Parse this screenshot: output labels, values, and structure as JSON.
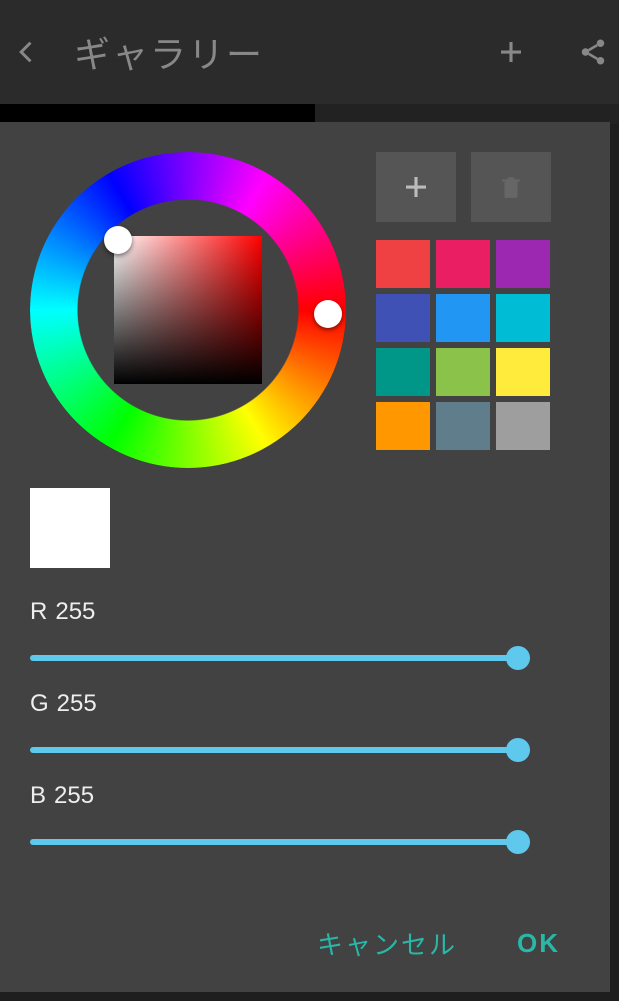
{
  "header": {
    "title": "ギャラリー"
  },
  "picker": {
    "preview_color": "#ffffff",
    "hue_base": "#ff0000",
    "swatches": [
      "#ef4144",
      "#e91e63",
      "#9c27b0",
      "#3f51b5",
      "#2196f3",
      "#00bcd4",
      "#009688",
      "#8bc34a",
      "#ffeb3b",
      "#ff9800",
      "#607d8b",
      "#9e9e9e"
    ]
  },
  "sliders": {
    "r": {
      "label": "R",
      "value": "255",
      "percent": 100
    },
    "g": {
      "label": "G",
      "value": "255",
      "percent": 100
    },
    "b": {
      "label": "B",
      "value": "255",
      "percent": 100
    }
  },
  "footer": {
    "cancel": "キャンセル",
    "ok": "OK"
  }
}
